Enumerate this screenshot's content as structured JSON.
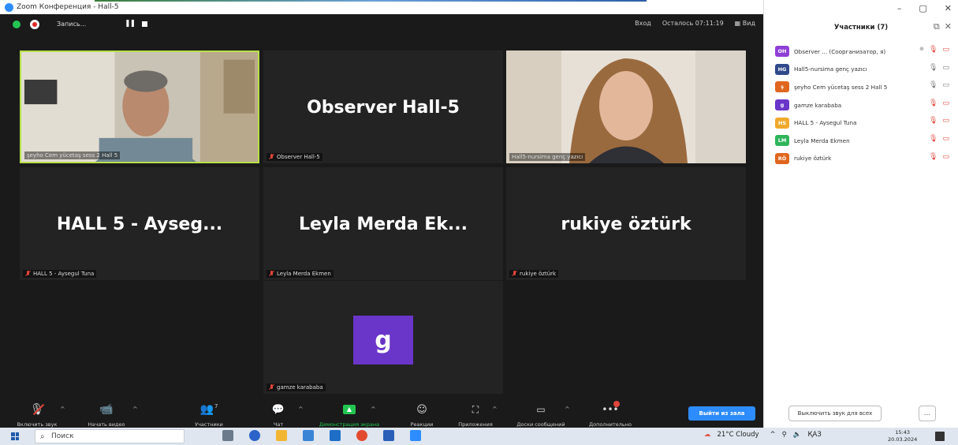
{
  "window": {
    "title": "Zoom Конференция - Hall-5"
  },
  "topbar": {
    "record_label": "Запись...",
    "enter_label": "Вход",
    "remaining_label": "Осталось 07:11:19",
    "view_label": "Вид"
  },
  "tiles": [
    {
      "id": "t1",
      "big": "",
      "tag": "şeyho Cem yücetaş sess 2 Hall 5",
      "muted": false,
      "video": "man"
    },
    {
      "id": "t2",
      "big": "Observer Hall-5",
      "tag": "Observer Hall-5",
      "muted": true,
      "video": ""
    },
    {
      "id": "t3",
      "big": "",
      "tag": "Hall5-nursima genç yazıcı",
      "muted": false,
      "video": "woman"
    },
    {
      "id": "t4",
      "big": "HALL 5 - Ayseg...",
      "tag": "HALL 5 - Aysegul Tuna",
      "muted": true,
      "video": ""
    },
    {
      "id": "t5",
      "big": "Leyla Merda Ek...",
      "tag": "Leyla Merda Ekmen",
      "muted": true,
      "video": ""
    },
    {
      "id": "t6",
      "big": "rukiye öztürk",
      "tag": "rukiye öztürk",
      "muted": true,
      "video": ""
    },
    {
      "id": "t7",
      "big": "",
      "avatar": "g",
      "tag": "gamze karababa",
      "muted": true,
      "video": ""
    }
  ],
  "toolbar": {
    "audio": "Включить звук",
    "video": "Начать видео",
    "participants": "Участники",
    "participants_count": "7",
    "chat": "Чат",
    "share": "Демонстрация экрана",
    "reactions": "Реакции",
    "apps": "Приложения",
    "whiteboards": "Доски сообщений",
    "more": "Дополнительно",
    "leave": "Выйти из зала"
  },
  "panel": {
    "title": "Участники (7)",
    "participants": [
      {
        "initials": "OH",
        "color": "#8e3fd6",
        "name": "Observer ... (Соорганизатор, я)",
        "mic": "off",
        "cam": "off",
        "extra": "🛡"
      },
      {
        "initials": "HG",
        "color": "#2f4a8a",
        "name": "Hall5-nursima genç yazıcı",
        "mic": "on",
        "cam": "on"
      },
      {
        "initials": "ş",
        "color": "#e0661e",
        "name": "şeyho Cem yücetaş sess 2 Hall 5",
        "mic": "on",
        "cam": "on"
      },
      {
        "initials": "g",
        "color": "#6a35c9",
        "name": "gamze karababa",
        "mic": "off",
        "cam": "off"
      },
      {
        "initials": "HS",
        "color": "#f0a92c",
        "name": "HALL 5 - Aysegul Tuna",
        "mic": "off",
        "cam": "off"
      },
      {
        "initials": "LM",
        "color": "#2fb45a",
        "name": "Leyla Merda Ekmen",
        "mic": "off",
        "cam": "off"
      },
      {
        "initials": "RÖ",
        "color": "#e0661e",
        "name": "rukiye öztürk",
        "mic": "off",
        "cam": "off"
      }
    ],
    "mute_all": "Выключить звук для всех",
    "more": "..."
  },
  "taskbar": {
    "search_placeholder": "Поиск",
    "weather": "21°C Cloudy",
    "lang": "ҚАЗ",
    "time": "15:43",
    "date": "20.03.2024"
  }
}
